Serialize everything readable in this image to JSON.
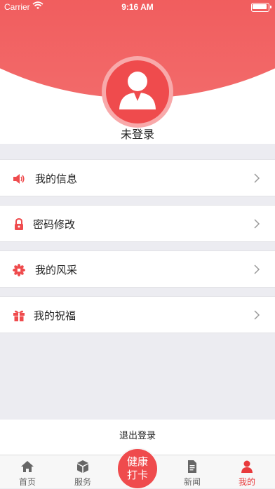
{
  "status_bar": {
    "carrier": "Carrier",
    "time": "9:16 AM"
  },
  "profile": {
    "login_status": "未登录"
  },
  "menu": [
    {
      "label": "我的信息",
      "icon": "speaker-icon"
    },
    {
      "label": "密码修改",
      "icon": "lock-icon"
    },
    {
      "label": "我的风采",
      "icon": "flower-icon"
    },
    {
      "label": "我的祝福",
      "icon": "gift-icon"
    }
  ],
  "logout_label": "退出登录",
  "tabbar": {
    "tabs": [
      {
        "label": "首页",
        "icon": "home-icon"
      },
      {
        "label": "服务",
        "icon": "box-icon"
      },
      {
        "label": "新闻",
        "icon": "document-icon"
      },
      {
        "label": "我的",
        "icon": "user-icon",
        "active": true
      }
    ],
    "checkin_line1": "健康",
    "checkin_line2": "打卡"
  },
  "colors": {
    "accent": "#ef4b4d",
    "background": "#ececf1"
  }
}
